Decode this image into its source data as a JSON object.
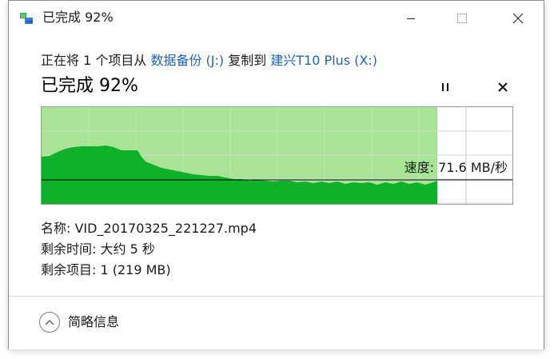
{
  "window": {
    "title": "已完成 92%",
    "icon": "file-copy-icon"
  },
  "transfer": {
    "prefix": "正在将 1 个项目从 ",
    "source": "数据备份 (J:)",
    "middle": " 复制到 ",
    "destination": "建兴T10 Plus (X:)"
  },
  "status": {
    "percent_text": "已完成 92%",
    "progress": 0.92
  },
  "graph": {
    "speed_text": "速度: 71.6 MB/秒",
    "fill_color": "#a8e496",
    "speed_color": "#0fb02a",
    "grid_color": "#c8c8c8",
    "line_color": "#000000"
  },
  "details": {
    "name_label": "名称: ",
    "name_value": "VID_20170325_221227.mp4",
    "time_label": "剩余时间: ",
    "time_value": "大约 5 秒",
    "items_label": "剩余项目: ",
    "items_value": "1 (219 MB)"
  },
  "footer": {
    "more_label": "简略信息"
  },
  "colors": {
    "link": "#1a63c4",
    "progress_fill": "#a8e496",
    "speed_area": "#0fb02a"
  }
}
